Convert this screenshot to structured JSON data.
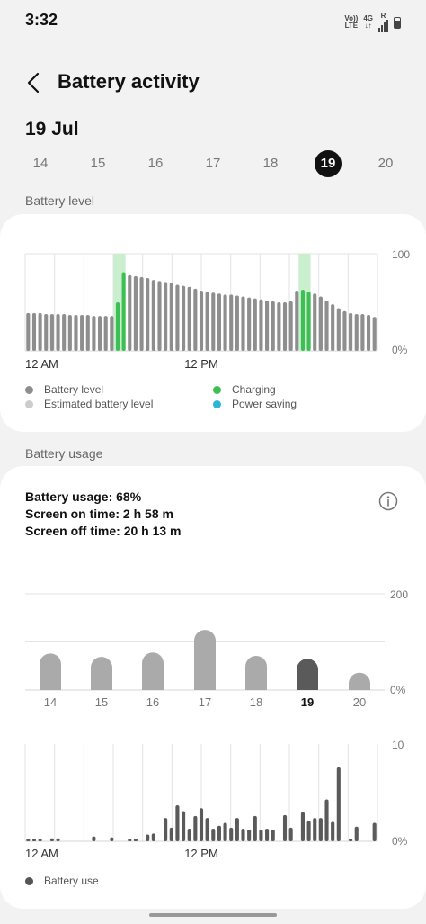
{
  "status_bar": {
    "time": "3:32",
    "volte_top": "Vo))",
    "volte_bottom": "LTE",
    "net_top": "4G",
    "net_bottom": "↓↑",
    "roaming": "R"
  },
  "header": {
    "title": "Battery activity"
  },
  "date_title": "19 Jul",
  "days": [
    {
      "label": "14",
      "selected": false
    },
    {
      "label": "15",
      "selected": false
    },
    {
      "label": "16",
      "selected": false
    },
    {
      "label": "17",
      "selected": false
    },
    {
      "label": "18",
      "selected": false
    },
    {
      "label": "19",
      "selected": true
    },
    {
      "label": "20",
      "selected": false
    }
  ],
  "battery_level_section": {
    "label": "Battery level"
  },
  "battery_level_legend": {
    "battery_level": "Battery level",
    "estimated": "Estimated battery level",
    "charging": "Charging",
    "power_saving": "Power saving"
  },
  "battery_usage_section": {
    "label": "Battery usage"
  },
  "battery_usage_summary": {
    "usage": "Battery usage: 68%",
    "screen_on": "Screen on time: 2 h 58 m",
    "screen_off": "Screen off time: 20 h 13 m"
  },
  "battery_use_legend": "Battery use",
  "colors": {
    "gray_bar": "#8e8e8e",
    "charging": "#3dbf54",
    "charging_band": "#c9efcf",
    "power_saving": "#2bb5d8",
    "estimated": "#cccccc",
    "selected_bar": "#5a5a5a",
    "day_bar": "#aaaaaa"
  },
  "chart_data": [
    {
      "type": "bar",
      "name": "battery-level",
      "x_tick_labels": [
        "12 AM",
        "12 PM"
      ],
      "y_tick_labels": [
        "100",
        "0%"
      ],
      "ylim": [
        0,
        100
      ],
      "values": [
        39,
        39,
        39,
        38,
        38,
        38,
        38,
        37,
        37,
        37,
        37,
        36,
        36,
        36,
        36,
        50,
        81,
        78,
        77,
        76,
        75,
        73,
        72,
        71,
        70,
        68,
        67,
        66,
        64,
        62,
        61,
        60,
        59,
        58,
        58,
        57,
        56,
        55,
        54,
        53,
        52,
        51,
        50,
        50,
        51,
        62,
        63,
        61,
        59,
        56,
        52,
        48,
        44,
        41,
        39,
        38,
        38,
        37,
        35
      ],
      "charging": [
        15,
        16,
        46,
        47
      ],
      "charging_bands": [
        [
          15,
          16
        ],
        [
          46,
          47
        ]
      ],
      "grid": true
    },
    {
      "type": "bar",
      "name": "daily-usage",
      "categories": [
        "14",
        "15",
        "16",
        "17",
        "18",
        "19",
        "20"
      ],
      "values": [
        76,
        69,
        78,
        125,
        71,
        65,
        36
      ],
      "highlight": "19",
      "y_tick_labels": [
        "200",
        "0%"
      ],
      "ylim": [
        0,
        200
      ],
      "grid": true
    },
    {
      "type": "bar",
      "name": "hourly-use",
      "x_tick_labels": [
        "12 AM",
        "12 PM"
      ],
      "y_tick_labels": [
        "10",
        "0%"
      ],
      "ylim": [
        0,
        10
      ],
      "values": [
        0.2,
        0.2,
        0.2,
        0,
        0.3,
        0.3,
        0,
        0,
        0,
        0,
        0,
        0.5,
        0,
        0,
        0.4,
        0,
        0,
        0.2,
        0.2,
        0,
        0.7,
        0.8,
        0,
        2.4,
        1.4,
        3.7,
        3.1,
        1.3,
        2.6,
        3.4,
        2.4,
        1.3,
        1.6,
        1.9,
        1.4,
        2.4,
        1.3,
        1.2,
        2.6,
        1.2,
        1.3,
        1.2,
        0,
        2.7,
        1.4,
        0,
        3.0,
        2.1,
        2.4,
        2.4,
        4.3,
        2.0,
        7.6,
        0,
        0.2,
        1.5,
        0,
        0,
        1.9
      ],
      "grid": true
    }
  ]
}
